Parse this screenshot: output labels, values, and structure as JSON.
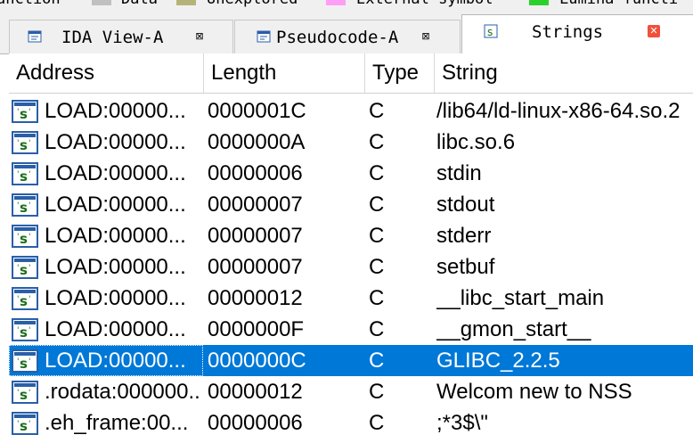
{
  "legend": {
    "items": [
      {
        "label": "unction",
        "color": ""
      },
      {
        "label": "Data",
        "color": "#c0c0c0"
      },
      {
        "label": "Unexplored",
        "color": "#b4b47a"
      },
      {
        "label": "External symbol",
        "color": "#ff9ef5"
      },
      {
        "label": "Lumina functi",
        "color": "#2bd12b"
      }
    ]
  },
  "tabs": [
    {
      "label": "IDA View-A",
      "icon": "ida-view-icon",
      "close": "⊠",
      "active": false
    },
    {
      "label": "Pseudocode-A",
      "icon": "pseudocode-icon",
      "close": "⊠",
      "active": false
    },
    {
      "label": "Strings",
      "icon": "strings-icon",
      "close": "✕",
      "active": true
    }
  ],
  "table": {
    "columns": [
      "Address",
      "Length",
      "Type",
      "String"
    ],
    "rows": [
      {
        "address": "LOAD:00000...",
        "length": "0000001C",
        "type": "C",
        "string": "/lib64/ld-linux-x86-64.so.2"
      },
      {
        "address": "LOAD:00000...",
        "length": "0000000A",
        "type": "C",
        "string": "libc.so.6"
      },
      {
        "address": "LOAD:00000...",
        "length": "00000006",
        "type": "C",
        "string": "stdin"
      },
      {
        "address": "LOAD:00000...",
        "length": "00000007",
        "type": "C",
        "string": "stdout"
      },
      {
        "address": "LOAD:00000...",
        "length": "00000007",
        "type": "C",
        "string": "stderr"
      },
      {
        "address": "LOAD:00000...",
        "length": "00000007",
        "type": "C",
        "string": "setbuf"
      },
      {
        "address": "LOAD:00000...",
        "length": "00000012",
        "type": "C",
        "string": "__libc_start_main"
      },
      {
        "address": "LOAD:00000...",
        "length": "0000000F",
        "type": "C",
        "string": "__gmon_start__"
      },
      {
        "address": "LOAD:00000...",
        "length": "0000000C",
        "type": "C",
        "string": "GLIBC_2.2.5",
        "selected": true
      },
      {
        "address": ".rodata:000000...",
        "length": "00000012",
        "type": "C",
        "string": "Welcom new to NSS"
      },
      {
        "address": ".eh_frame:00...",
        "length": "00000006",
        "type": "C",
        "string": ";*3$\\\""
      }
    ],
    "row_icon": "string-item-icon",
    "selection_color": "#0078d7"
  }
}
